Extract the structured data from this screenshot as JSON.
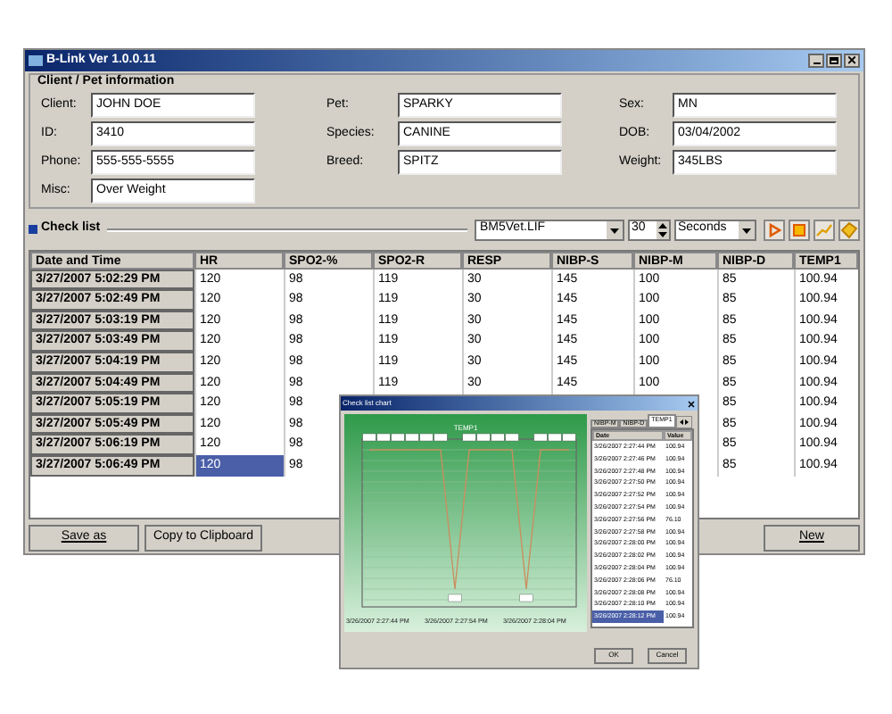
{
  "window": {
    "title": "B-Link Ver 1.0.0.11"
  },
  "client_info": {
    "title": "Client / Pet information",
    "fields": [
      {
        "label": "Client:",
        "value": "JOHN DOE"
      },
      {
        "label": "ID:",
        "value": "3410"
      },
      {
        "label": "Phone:",
        "value": "555-555-5555"
      },
      {
        "label": "Misc:",
        "value": "Over Weight"
      },
      {
        "label": "Pet:",
        "value": "SPARKY"
      },
      {
        "label": "Species:",
        "value": "CANINE"
      },
      {
        "label": "Breed:",
        "value": "SPITZ"
      },
      {
        "label": "Sex:",
        "value": "MN"
      },
      {
        "label": "DOB:",
        "value": "03/04/2002"
      },
      {
        "label": "Weight:",
        "value": "345LBS"
      }
    ]
  },
  "check_list": {
    "title": "Check list",
    "device": "BM5Vet.LIF",
    "interval": "30",
    "unit": "Seconds"
  },
  "table": {
    "columns": [
      "Date and Time",
      "HR",
      "SPO2-%",
      "SPO2-R",
      "RESP",
      "NIBP-S",
      "NIBP-M",
      "NIBP-D",
      "TEMP1"
    ],
    "rows": [
      {
        "time": "3/27/2007 5:02:29 PM",
        "values": [
          {
            "text": "120",
            "selected": false
          },
          {
            "text": "98",
            "selected": false
          },
          {
            "text": "119",
            "selected": false
          },
          {
            "text": "30",
            "selected": false
          },
          {
            "text": "145",
            "selected": false
          },
          {
            "text": "100",
            "selected": false
          },
          {
            "text": "85",
            "selected": false
          },
          {
            "text": "100.94",
            "selected": false
          }
        ]
      },
      {
        "time": "3/27/2007 5:02:49 PM",
        "values": [
          {
            "text": "120",
            "selected": false
          },
          {
            "text": "98",
            "selected": false
          },
          {
            "text": "119",
            "selected": false
          },
          {
            "text": "30",
            "selected": false
          },
          {
            "text": "145",
            "selected": false
          },
          {
            "text": "100",
            "selected": false
          },
          {
            "text": "85",
            "selected": false
          },
          {
            "text": "100.94",
            "selected": false
          }
        ]
      },
      {
        "time": "3/27/2007 5:03:19 PM",
        "values": [
          {
            "text": "120",
            "selected": false
          },
          {
            "text": "98",
            "selected": false
          },
          {
            "text": "119",
            "selected": false
          },
          {
            "text": "30",
            "selected": false
          },
          {
            "text": "145",
            "selected": false
          },
          {
            "text": "100",
            "selected": false
          },
          {
            "text": "85",
            "selected": false
          },
          {
            "text": "100.94",
            "selected": false
          }
        ]
      },
      {
        "time": "3/27/2007 5:03:49 PM",
        "values": [
          {
            "text": "120",
            "selected": false
          },
          {
            "text": "98",
            "selected": false
          },
          {
            "text": "119",
            "selected": false
          },
          {
            "text": "30",
            "selected": false
          },
          {
            "text": "145",
            "selected": false
          },
          {
            "text": "100",
            "selected": false
          },
          {
            "text": "85",
            "selected": false
          },
          {
            "text": "100.94",
            "selected": false
          }
        ]
      },
      {
        "time": "3/27/2007 5:04:19 PM",
        "values": [
          {
            "text": "120",
            "selected": false
          },
          {
            "text": "98",
            "selected": false
          },
          {
            "text": "119",
            "selected": false
          },
          {
            "text": "30",
            "selected": false
          },
          {
            "text": "145",
            "selected": false
          },
          {
            "text": "100",
            "selected": false
          },
          {
            "text": "85",
            "selected": false
          },
          {
            "text": "100.94",
            "selected": false
          }
        ]
      },
      {
        "time": "3/27/2007 5:04:49 PM",
        "values": [
          {
            "text": "120",
            "selected": false
          },
          {
            "text": "98",
            "selected": false
          },
          {
            "text": "119",
            "selected": false
          },
          {
            "text": "30",
            "selected": false
          },
          {
            "text": "145",
            "selected": false
          },
          {
            "text": "100",
            "selected": false
          },
          {
            "text": "85",
            "selected": false
          },
          {
            "text": "100.94",
            "selected": false
          }
        ]
      },
      {
        "time": "3/27/2007 5:05:19 PM",
        "values": [
          {
            "text": "120",
            "selected": false
          },
          {
            "text": "98",
            "selected": false
          }
        ],
        "values_right": [
          {
            "text": "85",
            "selected": false
          },
          {
            "text": "100.94",
            "selected": false
          }
        ]
      },
      {
        "time": "3/27/2007 5:05:49 PM",
        "values": [
          {
            "text": "120",
            "selected": false
          },
          {
            "text": "98",
            "selected": false
          }
        ],
        "values_right": [
          {
            "text": "85",
            "selected": false
          },
          {
            "text": "100.94",
            "selected": false
          }
        ]
      },
      {
        "time": "3/27/2007 5:06:19 PM",
        "values": [
          {
            "text": "120",
            "selected": false
          },
          {
            "text": "98",
            "selected": false
          }
        ],
        "values_right": [
          {
            "text": "85",
            "selected": false
          },
          {
            "text": "100.94",
            "selected": false
          }
        ]
      },
      {
        "time": "3/27/2007 5:06:49 PM",
        "values": [
          {
            "text": "120",
            "selected": true
          },
          {
            "text": "98",
            "selected": false
          }
        ],
        "values_right": [
          {
            "text": "85",
            "selected": false
          },
          {
            "text": "100.94",
            "selected": false
          }
        ]
      }
    ]
  },
  "buttons": [
    "Save as",
    "Copy to Clipboard",
    "New"
  ],
  "chart_dialog": {
    "title": "Check list chart",
    "chart_title": "TEMP1",
    "points": [
      {
        "kind": "high"
      },
      {
        "kind": "high"
      },
      {
        "kind": "high"
      },
      {
        "kind": "high"
      },
      {
        "kind": "high"
      },
      {
        "kind": "high"
      },
      {
        "kind": "low"
      },
      {
        "kind": "high"
      },
      {
        "kind": "high"
      },
      {
        "kind": "high"
      },
      {
        "kind": "high"
      },
      {
        "kind": "low"
      },
      {
        "kind": "high"
      },
      {
        "kind": "high"
      },
      {
        "kind": "high"
      }
    ],
    "x_labels": [
      "3/26/2007 2:27:44 PM",
      "3/26/2007 2:27:54 PM",
      "3/26/2007 2:28:04 PM"
    ],
    "tabs": [
      {
        "label": "NIBP-M",
        "selected": false
      },
      {
        "label": "NIBP-D",
        "selected": false
      },
      {
        "label": "TEMP1",
        "selected": true
      }
    ],
    "columns": [
      "Date",
      "Value"
    ],
    "rows": [
      {
        "date": "3/26/2007 2:27:44 PM",
        "value": "100.94",
        "selected": false
      },
      {
        "date": "3/26/2007 2:27:46 PM",
        "value": "100.94",
        "selected": false
      },
      {
        "date": "3/26/2007 2:27:48 PM",
        "value": "100.94",
        "selected": false
      },
      {
        "date": "3/26/2007 2:27:50 PM",
        "value": "100.94",
        "selected": false
      },
      {
        "date": "3/26/2007 2:27:52 PM",
        "value": "100.94",
        "selected": false
      },
      {
        "date": "3/26/2007 2:27:54 PM",
        "value": "100.94",
        "selected": false
      },
      {
        "date": "3/26/2007 2:27:56 PM",
        "value": "76.10",
        "selected": false
      },
      {
        "date": "3/26/2007 2:27:58 PM",
        "value": "100.94",
        "selected": false
      },
      {
        "date": "3/26/2007 2:28:00 PM",
        "value": "100.94",
        "selected": false
      },
      {
        "date": "3/26/2007 2:28:02 PM",
        "value": "100.94",
        "selected": false
      },
      {
        "date": "3/26/2007 2:28:04 PM",
        "value": "100.94",
        "selected": false
      },
      {
        "date": "3/26/2007 2:28:06 PM",
        "value": "76.10",
        "selected": false
      },
      {
        "date": "3/26/2007 2:28:08 PM",
        "value": "100.94",
        "selected": false
      },
      {
        "date": "3/26/2007 2:28:10 PM",
        "value": "100.94",
        "selected": false
      },
      {
        "date": "3/26/2007 2:28:12 PM",
        "value": "100.94",
        "selected": true
      }
    ],
    "buttons": [
      "OK",
      "Cancel"
    ]
  }
}
